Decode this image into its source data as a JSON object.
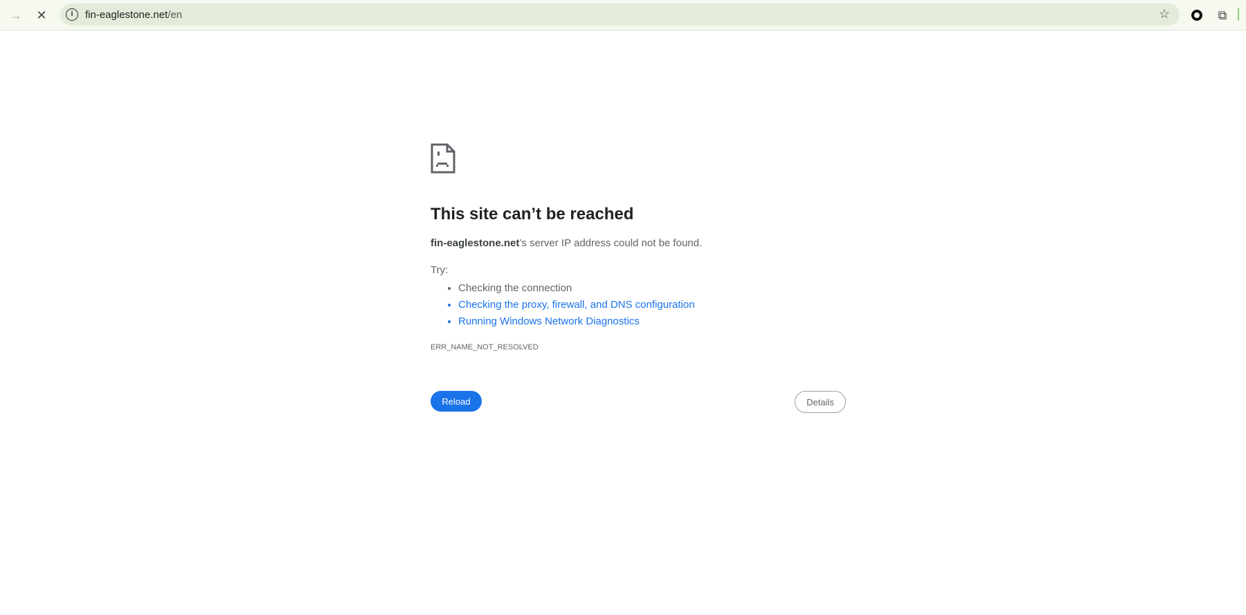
{
  "browser": {
    "url_host": "fin-eaglestone.net",
    "url_path": "/en",
    "icons": [
      "forward-icon",
      "stop-icon",
      "site-info-icon",
      "bookmark-star-icon",
      "profile-icon",
      "extensions-icon"
    ]
  },
  "error": {
    "title": "This site can’t be reached",
    "host": "fin-eaglestone.net",
    "description_rest": "’s server IP address could not be found.",
    "try_label": "Try:",
    "suggestions": [
      "Checking the connection",
      "Checking the proxy, firewall, and DNS configuration",
      "Running Windows Network Diagnostics"
    ],
    "code": "ERR_NAME_NOT_RESOLVED",
    "reload_label": "Reload",
    "details_label": "Details"
  },
  "colors": {
    "accent": "#1a73e8",
    "toolbar": "#f6f9f0",
    "omnibox": "#e3ecdb"
  }
}
